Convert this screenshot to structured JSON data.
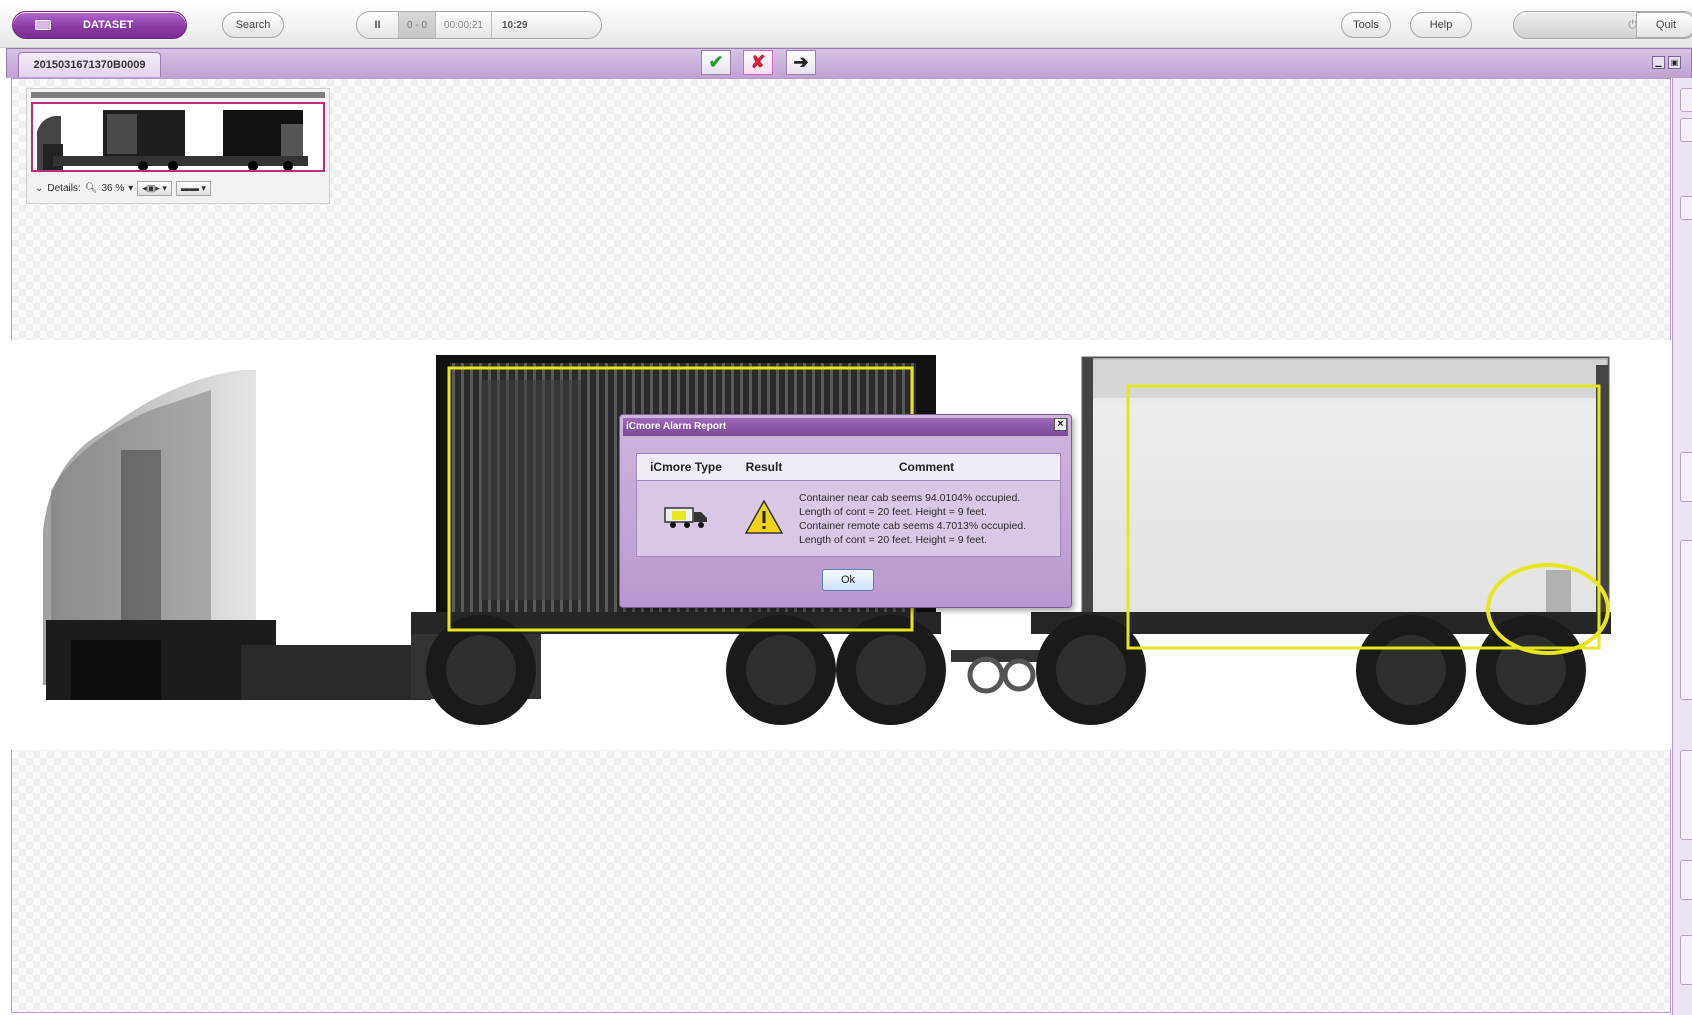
{
  "toolbar": {
    "dataset_label": "DATASET",
    "search_label": "Search",
    "pause_label": "II",
    "counter": "0 - 0",
    "elapsed": "00:00:21",
    "clock": "10:29",
    "tools_label": "Tools",
    "help_label": "Help",
    "quit_label": "Quit"
  },
  "header": {
    "scan_id": "2015031671370B0009"
  },
  "overview": {
    "details_label": "Details:",
    "zoom": "36 %"
  },
  "dialog": {
    "title": "iCmore Alarm Report",
    "columns": [
      "iCmore Type",
      "Result",
      "Comment"
    ],
    "comment_lines": [
      "Container near cab seems 94.0104% occupied.",
      "Length of cont = 20 feet. Height = 9 feet.",
      "Container remote cab seems   4.7013% occupied.",
      "Length of cont = 20 feet. Height = 9 feet."
    ],
    "ok_label": "Ok"
  },
  "colors": {
    "accent": "#8a3aa3",
    "header": "#c8aed9",
    "roi": "#e6e61e",
    "warning": "#f3d21a"
  }
}
